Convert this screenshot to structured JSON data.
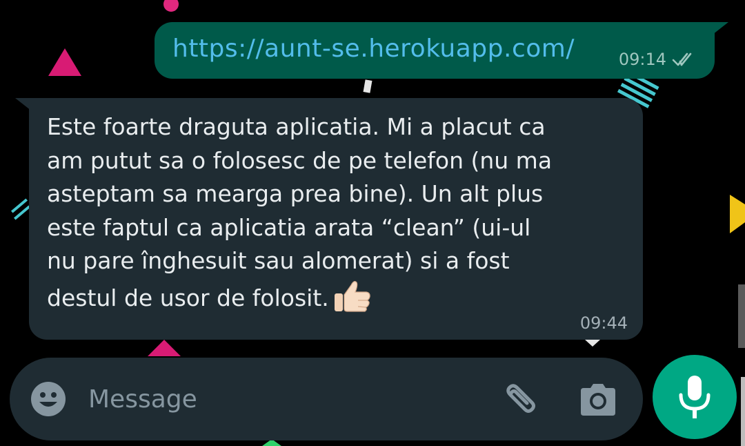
{
  "chat": {
    "outgoing": {
      "text": "https://aunt-se.herokuapp.com/",
      "time": "09:14",
      "status_icon": "double-check-icon"
    },
    "incoming": {
      "text": "Este foarte draguta aplicatia. Mi a placut ca\nam putut sa o folosesc de pe telefon (nu ma\nasteptam sa mearga prea bine). Un alt plus\neste faptul ca aplicatia arata “clean” (ui-ul\nnu pare înghesuit sau alomerat) si a fost\ndestul de usor de folosit.",
      "emoji": "thumbs-up-icon",
      "time": "09:44"
    }
  },
  "composer": {
    "placeholder": "Message",
    "value": "",
    "icons": [
      "emoji-icon",
      "attach-icon",
      "camera-icon",
      "mic-icon"
    ]
  },
  "colors": {
    "background": "#000000",
    "outgoing_bubble": "#005a4a",
    "incoming_bubble": "#1f2c33",
    "link": "#53bdeb",
    "mic_button": "#00a884"
  }
}
